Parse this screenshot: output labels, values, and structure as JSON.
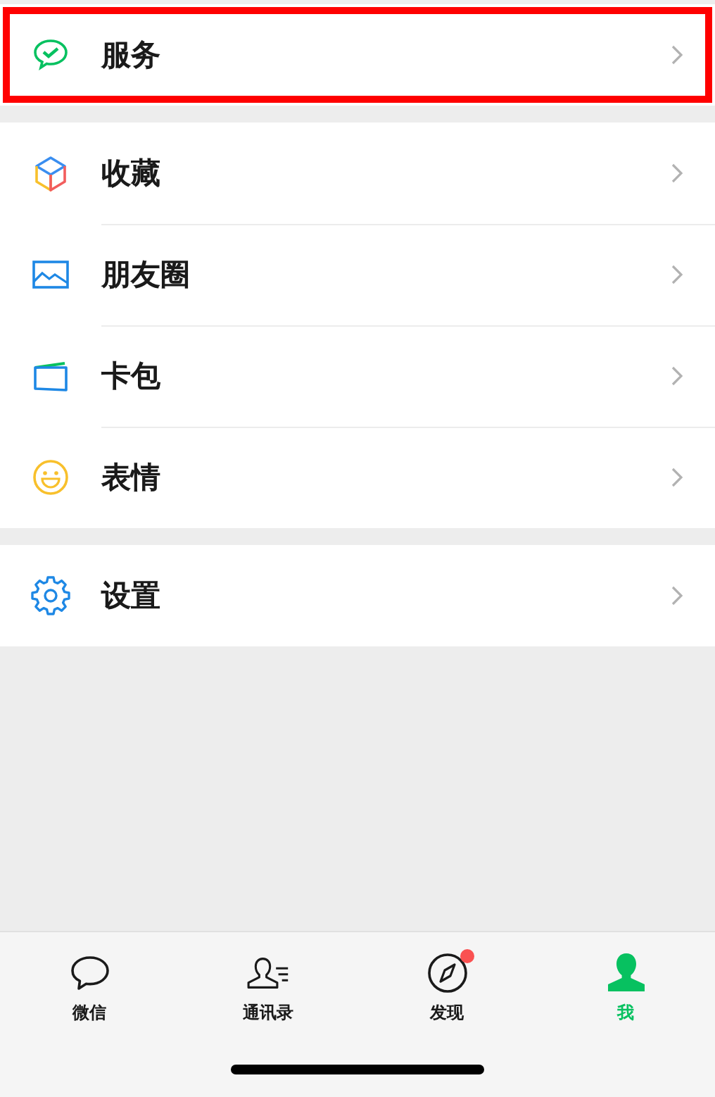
{
  "sections": [
    {
      "items": [
        {
          "kind": "service",
          "label": "服务",
          "highlighted": true
        }
      ]
    },
    {
      "items": [
        {
          "kind": "favorites",
          "label": "收藏",
          "highlighted": false
        },
        {
          "kind": "moments",
          "label": "朋友圈",
          "highlighted": false
        },
        {
          "kind": "cards",
          "label": "卡包",
          "highlighted": false
        },
        {
          "kind": "stickers",
          "label": "表情",
          "highlighted": false
        }
      ]
    },
    {
      "items": [
        {
          "kind": "settings",
          "label": "设置",
          "highlighted": false
        }
      ]
    }
  ],
  "tabs": [
    {
      "kind": "chat",
      "label": "微信",
      "selected": false,
      "dot": false
    },
    {
      "kind": "contacts",
      "label": "通讯录",
      "selected": false,
      "dot": false
    },
    {
      "kind": "discover",
      "label": "发现",
      "selected": false,
      "dot": true
    },
    {
      "kind": "me",
      "label": "我",
      "selected": true,
      "dot": false
    }
  ]
}
